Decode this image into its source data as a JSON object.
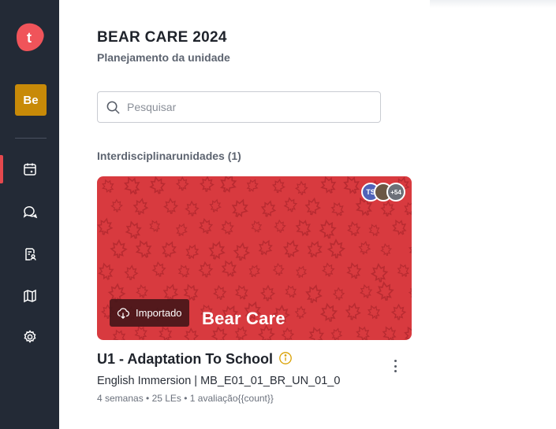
{
  "app": {
    "logo_letter": "t",
    "workspace_badge": "Be",
    "accent_color": "#f0545a",
    "sidebar_color": "#232a36"
  },
  "sidebar": {
    "items": [
      {
        "icon": "calendar-icon",
        "active": true
      },
      {
        "icon": "chat-icon",
        "active": false
      },
      {
        "icon": "student-report-icon",
        "active": false
      },
      {
        "icon": "map-icon",
        "active": false
      },
      {
        "icon": "gear-icon",
        "active": false
      }
    ]
  },
  "header": {
    "title": "BEAR CARE 2024",
    "subtitle": "Planejamento da unidade"
  },
  "search": {
    "placeholder": "Pesquisar"
  },
  "section": {
    "label": "Interdisciplinarunidades (1)"
  },
  "card": {
    "image_bg_color": "#d83a3f",
    "brand_text": "Bear Care",
    "imported_label": "Importado",
    "avatars": [
      {
        "initials": "TS"
      },
      {
        "initials": ""
      },
      {
        "initials": "+54"
      }
    ],
    "unit_title": "U1 - Adaptation To School",
    "unit_code": "English Immersion  | MB_E01_01_BR_UN_01_0",
    "meta": "4 semanas • 25 LEs • 1 avaliação{{count}}"
  }
}
